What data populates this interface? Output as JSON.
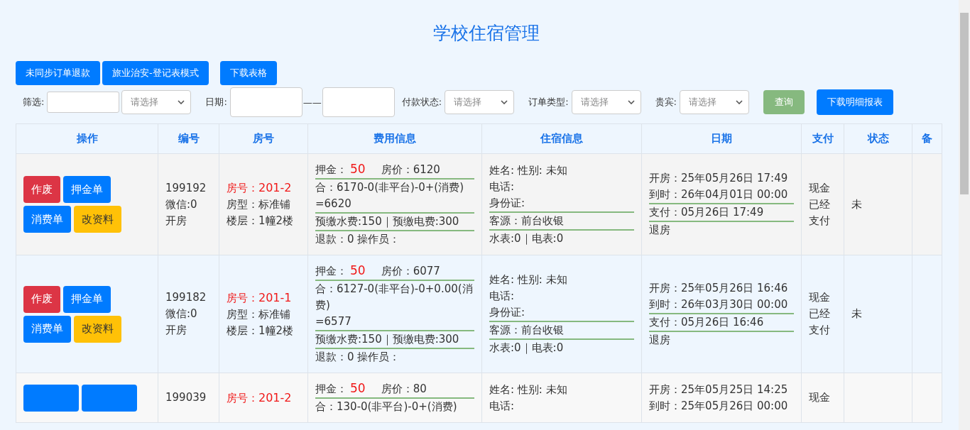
{
  "title": "学校住宿管理",
  "toolbar": [
    {
      "label": "未同步订单退款",
      "kind": "primary"
    },
    {
      "label": "旅业治安-登记表模式",
      "kind": "primary"
    },
    {
      "label": "下载表格",
      "kind": "primary"
    }
  ],
  "filters": {
    "filter_label": "筛选:",
    "filter_select": {
      "placeholder": "请选择"
    },
    "date_label": "日期:",
    "date_separator": "——",
    "payment_label": "付款状态:",
    "payment_select": {
      "placeholder": "请选择"
    },
    "order_type_label": "订单类型:",
    "order_type_select": {
      "placeholder": "请选择"
    },
    "vip_label": "贵宾:",
    "vip_select": {
      "placeholder": "请选择"
    },
    "buttons": [
      {
        "label": "查询",
        "kind": "success"
      },
      {
        "label": "下载明细报表",
        "kind": "primary"
      }
    ]
  },
  "table": {
    "columns": [
      "操作",
      "编号",
      "房号",
      "费用信息",
      "住宿信息",
      "日期",
      "支付",
      "状态",
      "备"
    ],
    "rows": [
      {
        "actions": [
          {
            "label": "作废",
            "kind": "danger"
          },
          {
            "label": "押金单",
            "kind": "primary"
          },
          {
            "label": "消费单",
            "kind": "primary"
          },
          {
            "label": "改资料",
            "kind": "warning"
          }
        ],
        "number": [
          "199192",
          "微信:0",
          "开房"
        ],
        "room": {
          "label": "房号：",
          "value": "201-2",
          "type": "房型：标准铺",
          "floor": "楼层：1幢2楼"
        },
        "fees": {
          "deposit_label": "押金：",
          "deposit": "50",
          "price": "房价：6120",
          "total": "合：6170-0(非平台)-0+(消费)",
          "result": "=6620",
          "prepaid": "预缴水费:150｜预缴电费:300",
          "refund": "退款：0 操作员："
        },
        "guest": {
          "name": "姓名:   性别: 未知",
          "phone": "电话:",
          "id_card": "身份证:",
          "source": "客源：前台收银",
          "meters": "水表:0｜电表:0"
        },
        "dates": {
          "open": "开房：25年05月26日 17:49",
          "due": "到时：26年04月01日 00:00",
          "paid": "支付：05月26日 17:49",
          "checkout": "退房"
        },
        "payment": "现金已经支付",
        "state": "未"
      },
      {
        "actions": [
          {
            "label": "作废",
            "kind": "danger"
          },
          {
            "label": "押金单",
            "kind": "primary"
          },
          {
            "label": "消费单",
            "kind": "primary"
          },
          {
            "label": "改资料",
            "kind": "warning"
          }
        ],
        "number": [
          "199182",
          "微信:0",
          "开房"
        ],
        "room": {
          "label": "房号：",
          "value": "201-1",
          "type": "房型：标准铺",
          "floor": "楼层：1幢2楼"
        },
        "fees": {
          "deposit_label": "押金：",
          "deposit": "50",
          "price": "房价：6077",
          "total": "合：6127-0(非平台)-0+0.00(消费)",
          "result": "=6577",
          "prepaid": "预缴水费:150｜预缴电费:300",
          "refund": "退款：0 操作员："
        },
        "guest": {
          "name": "姓名:   性别: 未知",
          "phone": "电话:",
          "id_card": "身份证:",
          "source": "客源：前台收银",
          "meters": "水表:0｜电表:0"
        },
        "dates": {
          "open": "开房：25年05月26日 16:46",
          "due": "到时：26年03月30日 00:00",
          "paid": "支付：05月26日 16:46",
          "checkout": "退房"
        },
        "payment": "现金已经支付",
        "state": "未"
      },
      {
        "actions": [
          {
            "kind": "primary"
          },
          {
            "kind": "primary"
          }
        ],
        "number": [
          "199039"
        ],
        "room": {
          "label": "房号：",
          "value": "201-2"
        },
        "fees": {
          "deposit_label": "押金：",
          "deposit": "50",
          "price": "房价：80",
          "total": "合：130-0(非平台)-0+(消费)"
        },
        "guest": {
          "name": "姓名:   性别: 未知",
          "phone": "电话:"
        },
        "dates": {
          "open": "开房：25年05月25日 14:25",
          "due": "到时：25年05月26日 00:00"
        },
        "payment": "现金"
      }
    ]
  }
}
